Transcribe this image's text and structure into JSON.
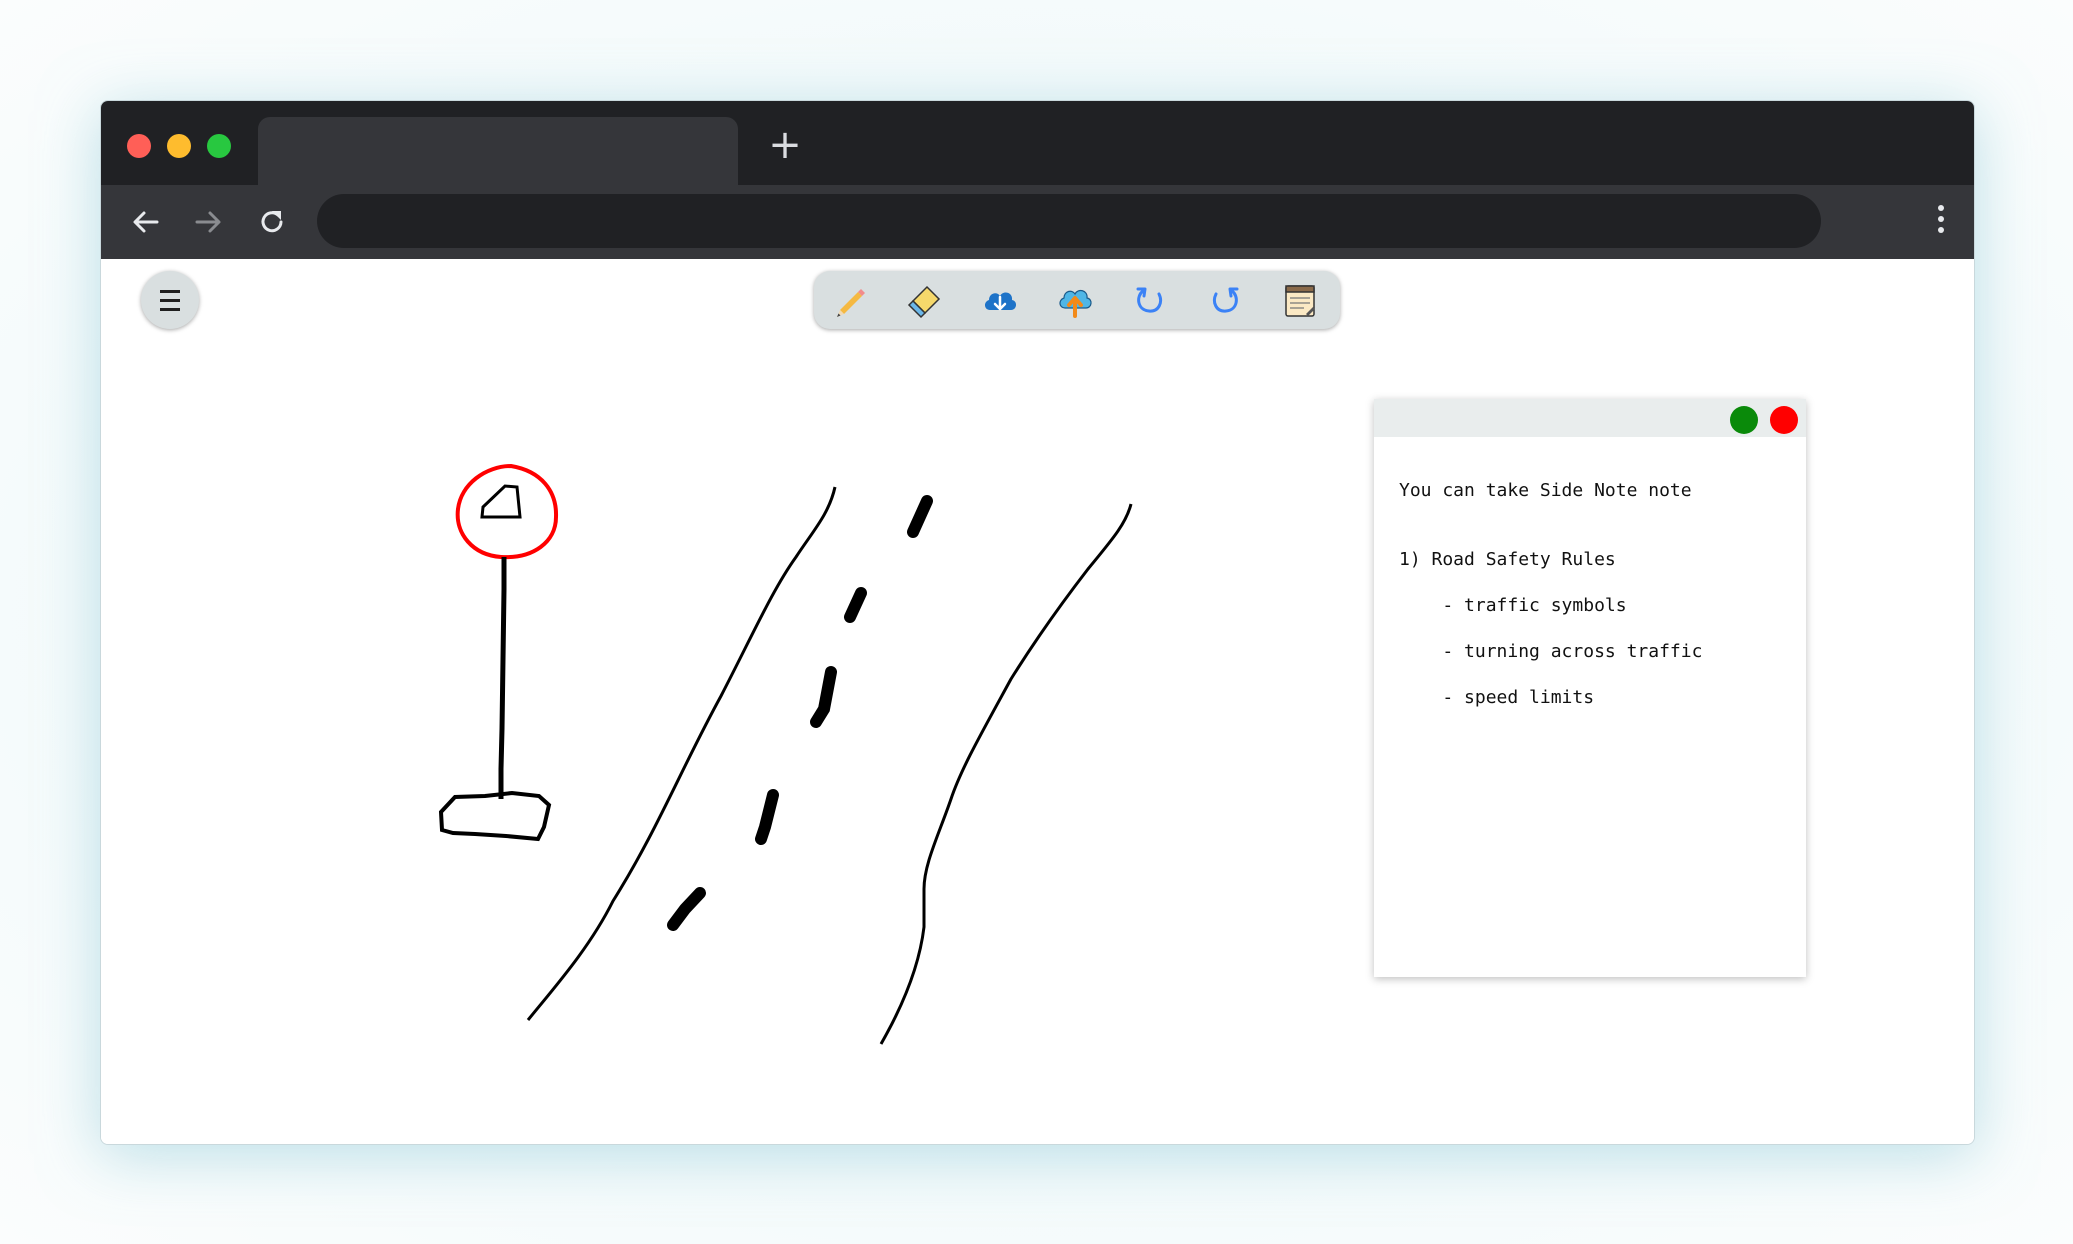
{
  "browser": {
    "tab_title": "",
    "new_tab_symbol": "+",
    "address": ""
  },
  "toolbar": {
    "tools": [
      {
        "name": "pencil",
        "icon": "pencil-icon"
      },
      {
        "name": "eraser",
        "icon": "eraser-icon"
      },
      {
        "name": "download",
        "icon": "cloud-download-icon"
      },
      {
        "name": "upload",
        "icon": "cloud-upload-icon"
      },
      {
        "name": "undo",
        "icon": "undo-icon"
      },
      {
        "name": "redo",
        "icon": "redo-icon"
      },
      {
        "name": "notepad",
        "icon": "notepad-icon"
      }
    ]
  },
  "drawing": {
    "sign_color": "#ff0000",
    "stroke_color": "#000000"
  },
  "sidenote": {
    "lines": [
      "You can take Side Note note",
      "1) Road Safety Rules",
      "    - traffic symbols",
      "    - turning across traffic",
      "    - speed limits"
    ],
    "save_color": "#0a8a0a",
    "close_color": "#ff0000"
  }
}
